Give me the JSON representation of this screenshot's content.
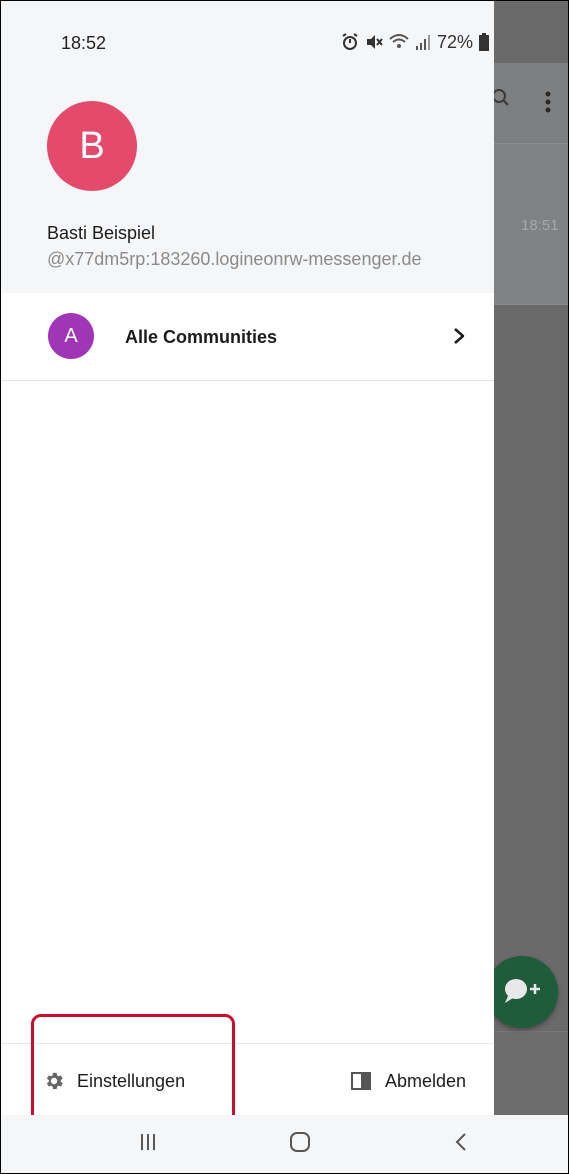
{
  "status_bar": {
    "time": "18:52",
    "battery": "72%",
    "icons": [
      "alarm-icon",
      "mute-icon",
      "wifi-icon",
      "signal-icon",
      "battery-icon"
    ]
  },
  "drawer": {
    "profile": {
      "avatar_letter": "B",
      "name": "Basti Beispiel",
      "user_id": "@x77dm5rp:183260.logineonrw-messenger.de"
    },
    "community": {
      "avatar_letter": "A",
      "label": "Alle Communities"
    },
    "footer": {
      "settings_label": "Einstellungen",
      "logout_label": "Abmelden"
    }
  },
  "background_app": {
    "list_item_time": "18:51"
  },
  "colors": {
    "avatar_b": "#e44a6b",
    "avatar_a": "#a036b5",
    "fab": "#1e5c3c",
    "highlight": "#c8102e",
    "scrim": "#6a6a6a"
  }
}
